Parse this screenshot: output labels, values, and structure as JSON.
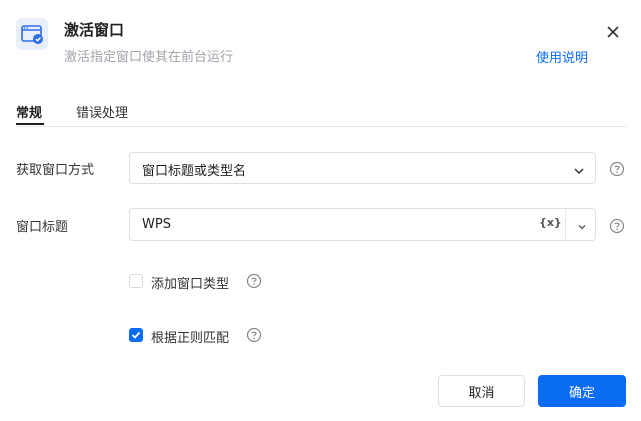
{
  "dialog": {
    "title": "激活窗口",
    "subtitle": "激活指定窗口使其在前台运行",
    "help_link": "使用说明"
  },
  "tabs": [
    {
      "label": "常规",
      "active": true
    },
    {
      "label": "错误处理",
      "active": false
    }
  ],
  "fields": {
    "method": {
      "label": "获取窗口方式",
      "value": "窗口标题或类型名"
    },
    "window_title": {
      "label": "窗口标题",
      "value": "WPS",
      "var_label": "{x}"
    }
  },
  "options": {
    "add_window_type": {
      "label": "添加窗口类型",
      "checked": false
    },
    "regex_match": {
      "label": "根据正则匹配",
      "checked": true
    }
  },
  "buttons": {
    "cancel": "取消",
    "ok": "确定"
  },
  "colors": {
    "accent": "#0a6cf2",
    "border": "#dcdfe5",
    "muted_text": "#a0a4ab"
  }
}
